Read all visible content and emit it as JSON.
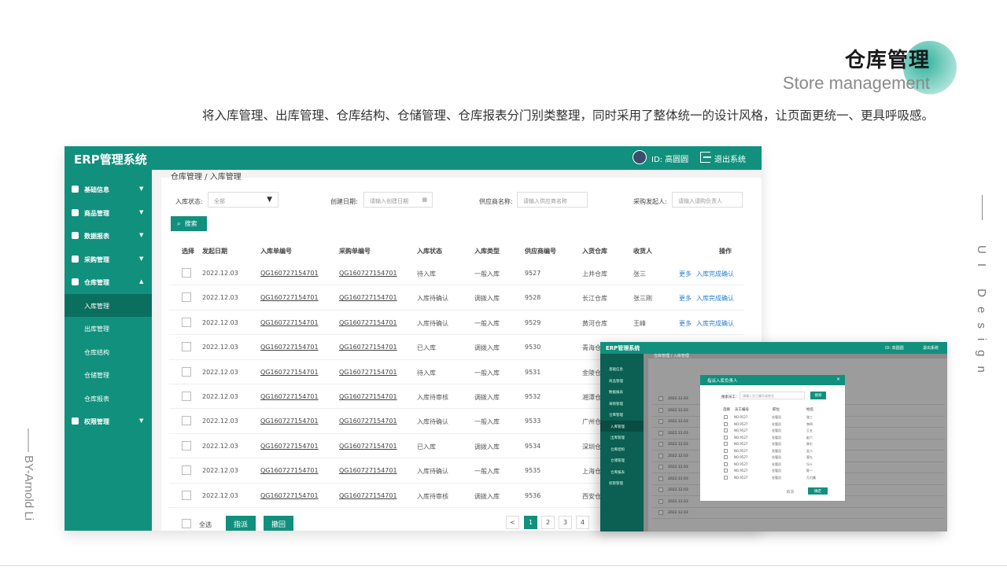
{
  "slide": {
    "title_cn": "仓库管理",
    "title_en": "Store management",
    "description": "将入库管理、出库管理、仓库结构、仓储管理、仓库报表分门别类整理，同时采用了整体统一的设计风格，让页面更统一、更具呼吸感。",
    "side_text": "UI Design",
    "author": "—— BY-Arnold Li"
  },
  "app": {
    "brand": "ERP管理系统",
    "user": "ID:  高圆圆",
    "logout": "退出系统",
    "colors": {
      "primary": "#11907d",
      "dark": "#0b6f60",
      "link": "#2a7ed0"
    }
  },
  "sidebar": {
    "items": [
      {
        "label": "基础信息",
        "arrow": "▼"
      },
      {
        "label": "商品管理",
        "arrow": "▼"
      },
      {
        "label": "数据报表",
        "arrow": "▼"
      },
      {
        "label": "采购管理",
        "arrow": "▼"
      },
      {
        "label": "仓库管理",
        "arrow": "▲"
      }
    ],
    "sub_items": [
      "入库管理",
      "出库管理",
      "仓库结构",
      "仓储管理",
      "仓库报表"
    ],
    "last_item": {
      "label": "权限管理",
      "arrow": "▼"
    }
  },
  "breadcrumb": "仓库管理 / 入库管理",
  "filters": {
    "status_label": "入库状态:",
    "status_value": "全部",
    "date_label": "创建日期:",
    "date_placeholder": "请输入创建日期",
    "supplier_label": "供应商名称:",
    "supplier_placeholder": "请输入供应商名称",
    "initiator_label": "采购发起人:",
    "initiator_placeholder": "请输入请购负责人",
    "search_button": "搜索"
  },
  "table": {
    "headers": [
      "选择",
      "发起日期",
      "入库单编号",
      "采购单编号",
      "入库状态",
      "入库类型",
      "供应商编号",
      "入货仓库",
      "收货人",
      "操作"
    ],
    "rows": [
      {
        "date": "2022.12.03",
        "in_no": "QG160727154701",
        "po_no": "QG160727154701",
        "status": "待入库",
        "type": "一般入库",
        "supplier": "9527",
        "warehouse": "上井仓库",
        "receiver": "张三",
        "more": "更多",
        "action": "入库完成确认"
      },
      {
        "date": "2022.12.03",
        "in_no": "QG160727154701",
        "po_no": "QG160727154701",
        "status": "入库待确认",
        "type": "调拨入库",
        "supplier": "9528",
        "warehouse": "长江仓库",
        "receiver": "张三刚",
        "more": "更多",
        "action": "入库完成确认"
      },
      {
        "date": "2022.12.03",
        "in_no": "QG160727154701",
        "po_no": "QG160727154701",
        "status": "入库待确认",
        "type": "一般入库",
        "supplier": "9529",
        "warehouse": "黄河仓库",
        "receiver": "王峰",
        "more": "更多",
        "action": "入库完成确认"
      },
      {
        "date": "2022.12.03",
        "in_no": "QG160727154701",
        "po_no": "QG160727154701",
        "status": "已入库",
        "type": "调拨入库",
        "supplier": "9530",
        "warehouse": "青海仓",
        "receiver": "",
        "more": "",
        "action": ""
      },
      {
        "date": "2022.12.03",
        "in_no": "QG160727154701",
        "po_no": "QG160727154701",
        "status": "待入库",
        "type": "一般入库",
        "supplier": "9531",
        "warehouse": "金陵仓",
        "receiver": "",
        "more": "",
        "action": ""
      },
      {
        "date": "2022.12.03",
        "in_no": "QG160727154701",
        "po_no": "QG160727154701",
        "status": "入库待审核",
        "type": "调拨入库",
        "supplier": "9532",
        "warehouse": "湘潭仓",
        "receiver": "",
        "more": "",
        "action": ""
      },
      {
        "date": "2022.12.03",
        "in_no": "QG160727154701",
        "po_no": "QG160727154701",
        "status": "入库待确认",
        "type": "一般入库",
        "supplier": "9533",
        "warehouse": "广州仓",
        "receiver": "",
        "more": "",
        "action": ""
      },
      {
        "date": "2022.12.03",
        "in_no": "QG160727154701",
        "po_no": "QG160727154701",
        "status": "已入库",
        "type": "调拨入库",
        "supplier": "9534",
        "warehouse": "深圳仓",
        "receiver": "",
        "more": "",
        "action": ""
      },
      {
        "date": "2022.12.03",
        "in_no": "QG160727154701",
        "po_no": "QG160727154701",
        "status": "入库待确认",
        "type": "一般入库",
        "supplier": "9535",
        "warehouse": "上海仓",
        "receiver": "",
        "more": "",
        "action": ""
      },
      {
        "date": "2022.12.03",
        "in_no": "QG160727154701",
        "po_no": "QG160727154701",
        "status": "入库待审核",
        "type": "调拨入库",
        "supplier": "9536",
        "warehouse": "西安仓",
        "receiver": "",
        "more": "",
        "action": ""
      }
    ]
  },
  "footer": {
    "select_all": "全选",
    "assign_button": "指派",
    "revoke_button": "撤回",
    "prev": "<",
    "pages": [
      "1",
      "2",
      "3",
      "4"
    ]
  },
  "overlay": {
    "brand": "ERP管理系统",
    "user": "ID: 高圆圆",
    "logout": "退出系统",
    "breadcrumb": "仓库管理 / 入库管理",
    "modal": {
      "title": "指派入库负责人",
      "close": "×",
      "search_label": "搜索员工：",
      "search_placeholder": "请输入员工编号或姓名",
      "search_button": "搜索",
      "headers": [
        "选择",
        "员工编号",
        "职位",
        "姓名"
      ],
      "rows": [
        {
          "id": "NO.9527",
          "role": "仓管员",
          "name": "张三"
        },
        {
          "id": "NO.9527",
          "role": "仓管员",
          "name": "李四"
        },
        {
          "id": "NO.9527",
          "role": "仓管员",
          "name": "王五"
        },
        {
          "id": "NO.9527",
          "role": "仓管员",
          "name": "赵六"
        },
        {
          "id": "NO.9527",
          "role": "仓管员",
          "name": "周七"
        },
        {
          "id": "NO.9527",
          "role": "仓管员",
          "name": "吴八"
        },
        {
          "id": "NO.9527",
          "role": "仓管员",
          "name": "郑九"
        },
        {
          "id": "NO.9527",
          "role": "仓管员",
          "name": "冯十"
        },
        {
          "id": "NO.9527",
          "role": "仓管员",
          "name": "陈一"
        },
        {
          "id": "NO.9527",
          "role": "仓管员",
          "name": "万刀美"
        }
      ],
      "cancel": "取消",
      "confirm": "确定"
    }
  }
}
